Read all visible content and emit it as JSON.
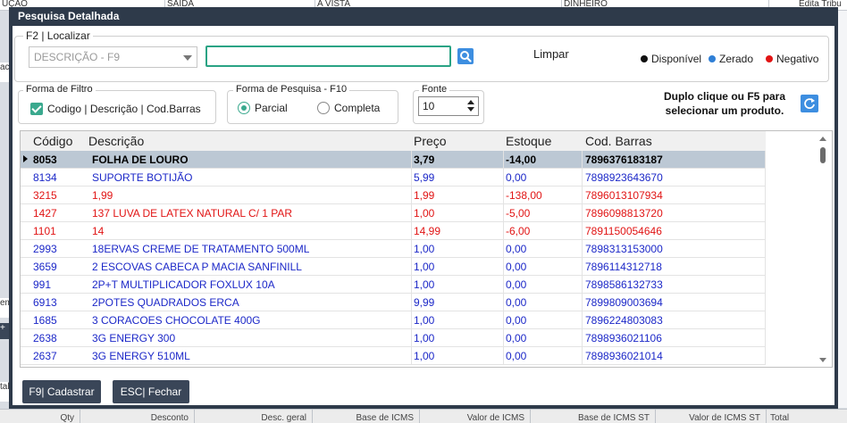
{
  "background": {
    "top_cells": [
      "UÇÃO",
      "SAÍDA",
      "A VISTA",
      "DINHEIRO",
      "Edita Tribu"
    ],
    "left_fragments": [
      "ac",
      "em",
      "+",
      "tal"
    ],
    "bottom_cells": [
      "Qty",
      "Desconto",
      "Desc. geral",
      "Base de ICMS",
      "Valor de ICMS",
      "Base de ICMS ST",
      "Valor de ICMS ST",
      "Total"
    ]
  },
  "dialog": {
    "title": "Pesquisa Detalhada",
    "localizar_label": "F2 | Localizar",
    "field_select_value": "DESCRIÇÃO -   F9",
    "search_value": "",
    "search_icon": "magnifier-icon",
    "limpar_label": "Limpar",
    "legend": [
      {
        "label": "Disponível",
        "color": "#111111"
      },
      {
        "label": "Zerado",
        "color": "#2f7fd6"
      },
      {
        "label": "Negativo",
        "color": "#e11414"
      }
    ],
    "filter_group_label": "Forma de Filtro",
    "filter_checkbox_label": "Codigo | Descrição | Cod.Barras",
    "filter_checked": true,
    "search_mode_label": "Forma de Pesquisa - F10",
    "search_modes": [
      {
        "label": "Parcial",
        "selected": true
      },
      {
        "label": "Completa",
        "selected": false
      }
    ],
    "font_label": "Fonte",
    "font_size_value": "10",
    "hint": "Duplo clique ou F5 para selecionar um produto.",
    "refresh_icon": "refresh-icon"
  },
  "grid": {
    "columns": [
      "Código",
      "Descrição",
      "Preço",
      "Estoque",
      "Cod. Barras"
    ],
    "rows": [
      {
        "codigo": "8053",
        "descricao": " FOLHA DE LOURO",
        "preco": "3,79",
        "estoque": "-14,00",
        "barras": "7896376183187",
        "status": "selected"
      },
      {
        "codigo": "8134",
        "descricao": " SUPORTE BOTIJÃO",
        "preco": "5,99",
        "estoque": "0,00",
        "barras": "7898923643670",
        "status": "blue"
      },
      {
        "codigo": "3215",
        "descricao": "1,99",
        "preco": "1,99",
        "estoque": "-138,00",
        "barras": "7896013107934",
        "status": "red"
      },
      {
        "codigo": "1427",
        "descricao": "137 LUVA DE LATEX NATURAL C/ 1 PAR",
        "preco": "1,00",
        "estoque": "-5,00",
        "barras": "7896098813720",
        "status": "red"
      },
      {
        "codigo": "1101",
        "descricao": "14",
        "preco": "14,99",
        "estoque": "-6,00",
        "barras": "7891150054646",
        "status": "red"
      },
      {
        "codigo": "2993",
        "descricao": "18ERVAS CREME DE TRATAMENTO 500ML",
        "preco": "1,00",
        "estoque": "0,00",
        "barras": "7898313153000",
        "status": "blue"
      },
      {
        "codigo": "3659",
        "descricao": "2 ESCOVAS CABECA P MACIA SANFINILL",
        "preco": "1,00",
        "estoque": "0,00",
        "barras": "7896114312718",
        "status": "blue"
      },
      {
        "codigo": "991",
        "descricao": "2P+T MULTIPLICADOR FOXLUX 10A",
        "preco": "1,00",
        "estoque": "0,00",
        "barras": "7898586132733",
        "status": "blue"
      },
      {
        "codigo": "6913",
        "descricao": "2POTES QUADRADOS ERCA",
        "preco": "9,99",
        "estoque": "0,00",
        "barras": "7899809003694",
        "status": "blue"
      },
      {
        "codigo": "1685",
        "descricao": "3 CORACOES CHOCOLATE 400G",
        "preco": "1,00",
        "estoque": "0,00",
        "barras": "7896224803083",
        "status": "blue"
      },
      {
        "codigo": "2638",
        "descricao": "3G ENERGY 300",
        "preco": "1,00",
        "estoque": "0,00",
        "barras": "7898936021106",
        "status": "blue"
      },
      {
        "codigo": "2637",
        "descricao": "3G ENERGY 510ML",
        "preco": "1,00",
        "estoque": "0,00",
        "barras": "7898936021014",
        "status": "blue"
      }
    ]
  },
  "footer": {
    "cadastrar_label": "F9| Cadastrar",
    "fechar_label": "ESC| Fechar"
  }
}
